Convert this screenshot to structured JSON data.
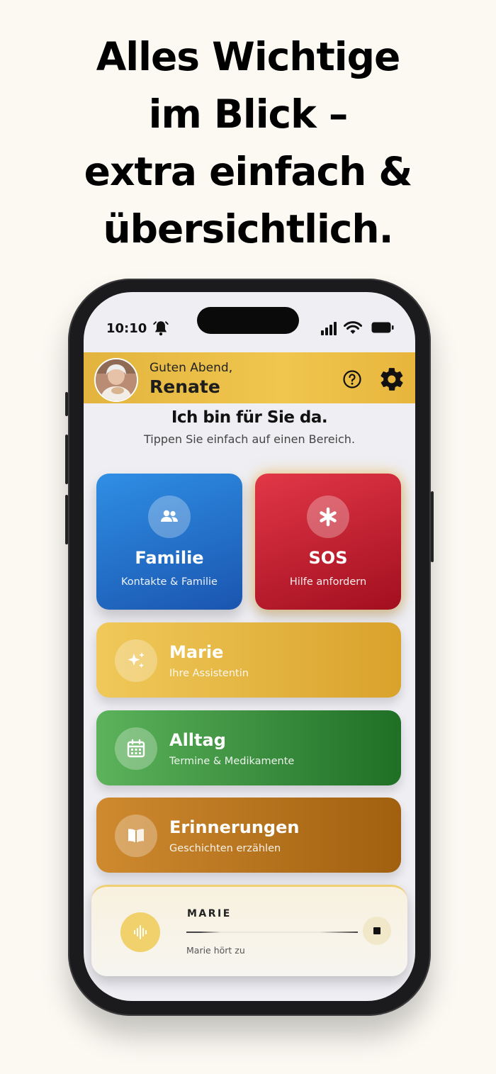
{
  "headline": [
    "Alles Wichtige",
    "im Blick –",
    "extra einfach &",
    "übersichtlich."
  ],
  "status_bar": {
    "time": "10:10"
  },
  "header": {
    "greeting": "Guten Abend,",
    "username": "Renate"
  },
  "main": {
    "title": "Ich bin für Sie da.",
    "subtitle": "Tippen Sie einfach auf einen Bereich.",
    "tiles": [
      {
        "label": "Familie",
        "sub": "Kontakte & Familie",
        "icon": "people-icon",
        "color": "#2a7fd8"
      },
      {
        "label": "SOS",
        "sub": "Hilfe anfordern",
        "icon": "asterisk-icon",
        "color": "#c81e2e"
      }
    ],
    "rows": [
      {
        "label": "Marie",
        "sub": "Ihre Assistentin",
        "icon": "sparkle-icon",
        "color": "#e6b445"
      },
      {
        "label": "Alltag",
        "sub": "Termine & Medikamente",
        "icon": "calendar-icon",
        "color": "#3d923d"
      },
      {
        "label": "Erinnerungen",
        "sub": "Geschichten erzählen",
        "icon": "book-icon",
        "color": "#b8771f"
      }
    ]
  },
  "assistant": {
    "name": "MARIE",
    "status": "Marie hört zu"
  },
  "colors": {
    "background": "#fcf9f3",
    "header_yellow": "#eebe48"
  }
}
